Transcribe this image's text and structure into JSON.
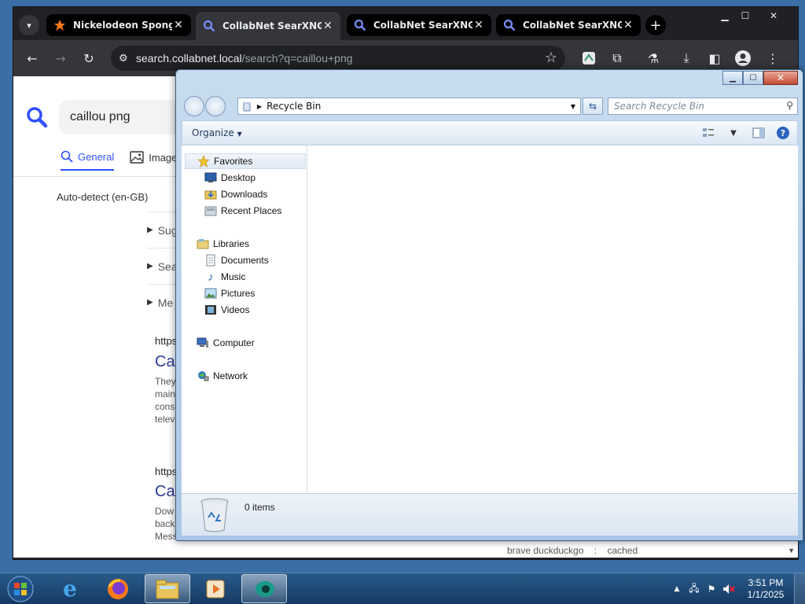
{
  "browser": {
    "tabs": [
      {
        "title": "Nickelodeon SpongeB",
        "active": false
      },
      {
        "title": "CollabNet SearXNG",
        "active": true
      },
      {
        "title": "CollabNet SearXNG",
        "active": false
      },
      {
        "title": "CollabNet SearXNG",
        "active": false
      }
    ],
    "address": {
      "host": "search.collabnet.local",
      "path": "/search?q=caillou+png"
    }
  },
  "page": {
    "query": "caillou png",
    "tabs": [
      {
        "label": "General",
        "active": true
      },
      {
        "label": "Images",
        "active": false
      }
    ],
    "language": "Auto-detect (en-GB)",
    "sidebar": [
      "Sug",
      "Sea",
      "Me"
    ],
    "results": [
      {
        "url": "https:",
        "title": "Cai",
        "snippet": [
          "They",
          "main",
          "cons",
          "telev"
        ]
      },
      {
        "url": "https:",
        "title": "Cai",
        "snippet": [
          "Dow",
          "back",
          "Mess"
        ]
      }
    ],
    "footer": {
      "engines": "brave  duckduckgo",
      "sep": ":",
      "cached": "cached"
    }
  },
  "explorer": {
    "location": "Recycle Bin",
    "search_placeholder": "Search Recycle Bin",
    "organize_label": "Organize",
    "nav": {
      "favorites": "Favorites",
      "desktop": "Desktop",
      "downloads": "Downloads",
      "recent": "Recent Places",
      "libraries": "Libraries",
      "documents": "Documents",
      "music": "Music",
      "pictures": "Pictures",
      "videos": "Videos",
      "computer": "Computer",
      "network": "Network"
    },
    "status": "0 items"
  },
  "taskbar": {
    "time": "3:51 PM",
    "date": "1/1/2025"
  },
  "colors": {
    "searx_blue": "#3050ff",
    "chrome_dark": "#202124",
    "taskbar": "#1c4a78"
  }
}
